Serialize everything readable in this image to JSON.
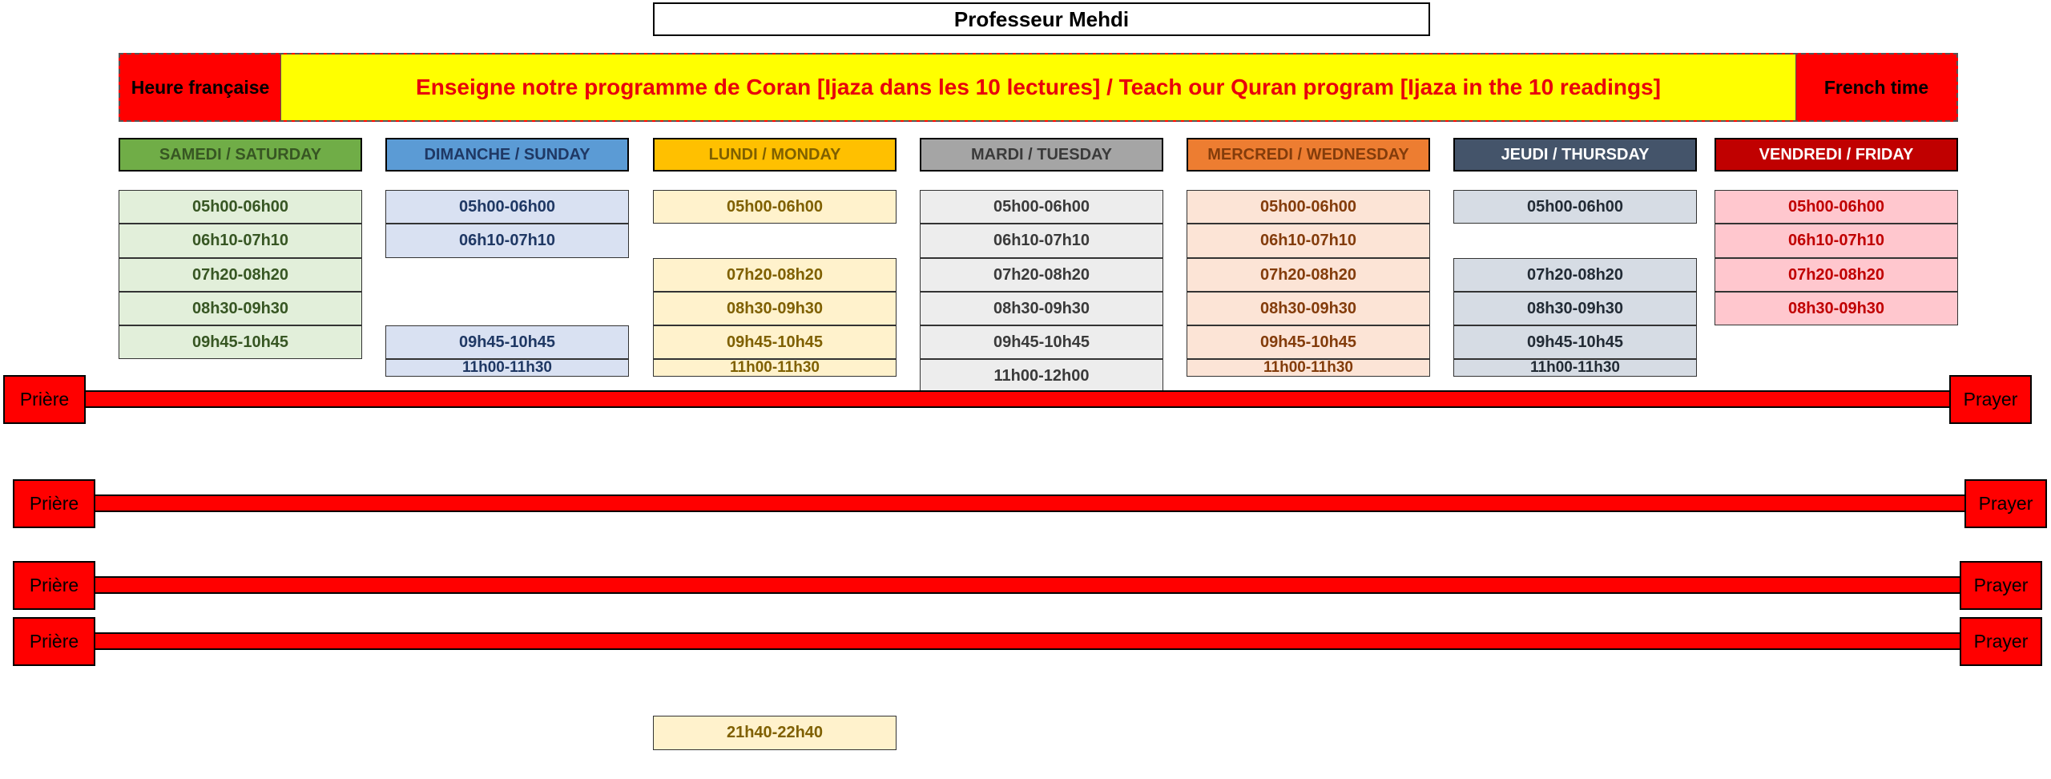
{
  "title": "Professeur Mehdi",
  "banner": {
    "left": "Heure française",
    "center": "Enseigne notre programme de Coran [Ijaza dans les 10 lectures] / Teach our Quran program [Ijaza in the 10 readings]",
    "right": "French time"
  },
  "days": [
    {
      "label": "SAMEDI / SATURDAY",
      "header_bg": "#70ad47",
      "header_text": "#375623",
      "slot_bg": "#e2efda",
      "slot_text": "#375623",
      "slots": [
        "05h00-06h00",
        "06h10-07h10",
        "07h20-08h20",
        "08h30-09h30",
        "09h45-10h45"
      ]
    },
    {
      "label": "DIMANCHE / SUNDAY",
      "header_bg": "#5b9bd5",
      "header_text": "#1f3864",
      "slot_bg": "#d9e1f2",
      "slot_text": "#1f3864",
      "slots": [
        "05h00-06h00",
        "06h10-07h10",
        "09h45-10h45",
        "11h00-11h30"
      ]
    },
    {
      "label": "LUNDI / MONDAY",
      "header_bg": "#ffc000",
      "header_text": "#7f6000",
      "slot_bg": "#fff2cc",
      "slot_text": "#7f6000",
      "slots": [
        "05h00-06h00",
        "07h20-08h20",
        "08h30-09h30",
        "09h45-10h45",
        "11h00-11h30",
        "21h40-22h40"
      ]
    },
    {
      "label": "MARDI / TUESDAY",
      "header_bg": "#a5a5a5",
      "header_text": "#3a3a3a",
      "slot_bg": "#ededed",
      "slot_text": "#3a3a3a",
      "slots": [
        "05h00-06h00",
        "06h10-07h10",
        "07h20-08h20",
        "08h30-09h30",
        "09h45-10h45",
        "11h00-12h00"
      ]
    },
    {
      "label": "MERCREDI / WEDNESDAY",
      "header_bg": "#ed7d31",
      "header_text": "#833c0b",
      "slot_bg": "#fce4d6",
      "slot_text": "#833c0b",
      "slots": [
        "05h00-06h00",
        "06h10-07h10",
        "07h20-08h20",
        "08h30-09h30",
        "09h45-10h45",
        "11h00-11h30"
      ]
    },
    {
      "label": "JEUDI / THURSDAY",
      "header_bg": "#44546a",
      "header_text": "#ffffff",
      "slot_bg": "#d6dce4",
      "slot_text": "#222b35",
      "slots": [
        "05h00-06h00",
        "07h20-08h20",
        "08h30-09h30",
        "09h45-10h45",
        "11h00-11h30"
      ]
    },
    {
      "label": "VENDREDI / FRIDAY",
      "header_bg": "#c00000",
      "header_text": "#ffffff",
      "slot_bg": "#ffc7ce",
      "slot_text": "#c00000",
      "slots": [
        "05h00-06h00",
        "06h10-07h10",
        "07h20-08h20",
        "08h30-09h30"
      ]
    }
  ],
  "prayers": [
    {
      "left": "Prière",
      "right": "Prayer"
    },
    {
      "left": "Prière",
      "right": "Prayer"
    },
    {
      "left": "Prière",
      "right": "Prayer"
    },
    {
      "left": "Prière",
      "right": "Prayer"
    }
  ]
}
